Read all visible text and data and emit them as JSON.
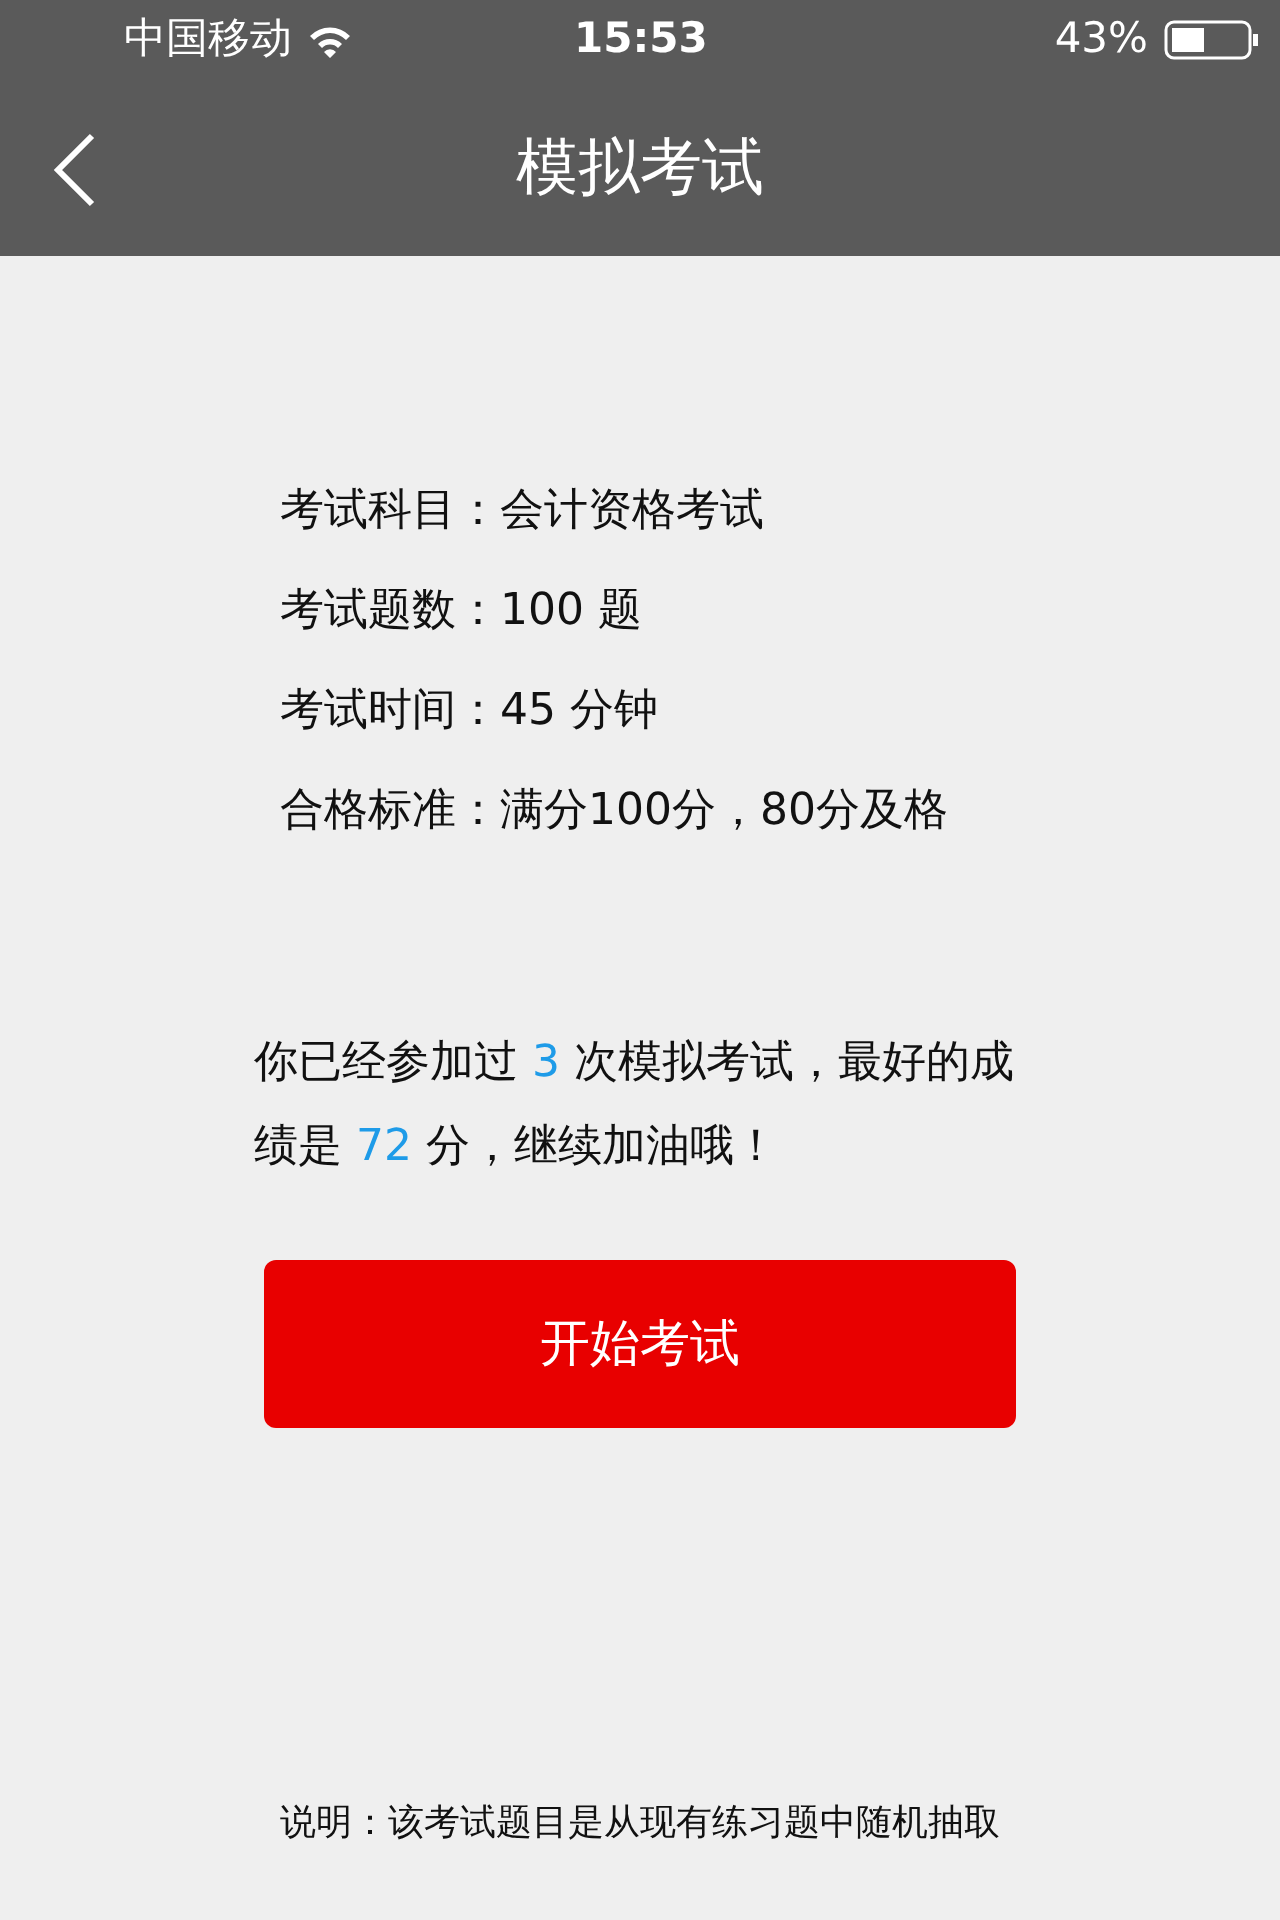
{
  "status_bar": {
    "carrier": "中国移动",
    "time": "15:53",
    "battery": "43%"
  },
  "nav": {
    "back": true,
    "title": "模拟考试"
  },
  "info": [
    "考试科目：会计资格考试",
    "考试题数：100 题",
    "考试时间：45 分钟",
    "合格标准：满分100分，80分及格"
  ],
  "summary": [
    {
      "text": "你已经参加过 ",
      "highlight": false
    },
    {
      "text": "3",
      "highlight": true
    },
    {
      "text": " 次模拟考试，最好的成绩是 ",
      "highlight": false
    },
    {
      "text": "72",
      "highlight": true
    },
    {
      "text": " 分，继续加油哦！",
      "highlight": false
    }
  ],
  "start_button": "开始考试",
  "note": "说明：该考试题目是从现有练习题中随机抽取"
}
